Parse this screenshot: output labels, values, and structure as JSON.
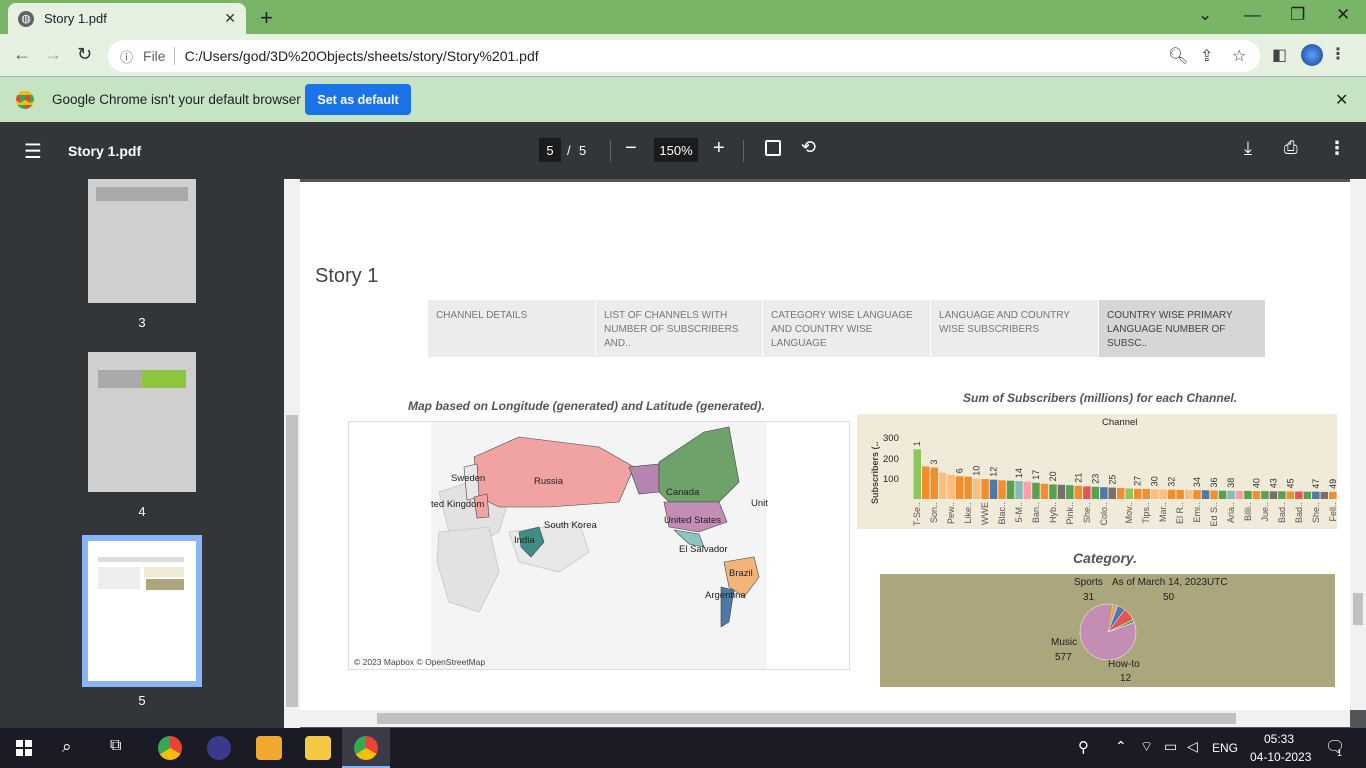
{
  "browser": {
    "tab_title": "Story 1.pdf",
    "tab_close": "✕",
    "new_tab": "+",
    "file_label": "File",
    "url": "C:/Users/god/3D%20Objects/sheets/story/Story%201.pdf",
    "infobar_message": "Google Chrome isn't your default browser",
    "set_default_label": "Set as default",
    "infobar_close": "✕"
  },
  "pdf": {
    "title": "Story 1.pdf",
    "current_page": "5",
    "page_sep": "/",
    "total_pages": "5",
    "zoom": "150%"
  },
  "thumbnails": [
    {
      "label": "3"
    },
    {
      "label": "4"
    },
    {
      "label": "5"
    }
  ],
  "story": {
    "title": "Story 1",
    "tabs": [
      "CHANNEL DETAILS",
      "LIST OF CHANNELS WITH NUMBER OF SUBSCRIBERS AND..",
      "CATEGORY WISE LANGUAGE AND COUNTRY WISE LANGUAGE",
      "LANGUAGE AND COUNTRY WISE SUBSCRIBERS",
      "COUNTRY WISE PRIMARY LANGUAGE NUMBER OF SUBSC.."
    ]
  },
  "map": {
    "title": "Map based on Longitude (generated) and Latitude (generated).",
    "attribution": "© 2023 Mapbox © OpenStreetMap",
    "labels": {
      "sweden": "Sweden",
      "uk": "ted Kingdom",
      "russia": "Russia",
      "south_korea": "South Korea",
      "india": "India",
      "canada": "Canada",
      "united_states": "United States",
      "el_salvador": "El Salvador",
      "brazil": "Brazil",
      "argentina": "Argentina",
      "unit": "Unit"
    }
  },
  "chart_data": [
    {
      "type": "bar",
      "title": "Sum of Subscribers (millions) for each Channel.",
      "header": "Channel",
      "ylabel": "Subscribers (..",
      "yticks": [
        "300",
        "200",
        "100"
      ],
      "ylim": [
        0,
        350
      ],
      "categories": [
        "T-Se..",
        "Son..",
        "Pew..",
        "Like..",
        "WWE",
        "Blac..",
        "5-M..",
        "Ban..",
        "Hyb..",
        "Pink..",
        "She..",
        "Colo..",
        "Mov..",
        "Tips..",
        "Mar..",
        "El R..",
        "Emi..",
        "Ed S..",
        "Aria..",
        "Billi..",
        "Jue..",
        "Bad..",
        "Bad..",
        "She..",
        "Fell.."
      ],
      "values": [
        245,
        160,
        155,
        130,
        120,
        112,
        110,
        100,
        98,
        95,
        92,
        90,
        88,
        85,
        80,
        75,
        72,
        70,
        68,
        65,
        62,
        60,
        58,
        56,
        54,
        52,
        50,
        50,
        48,
        47,
        46,
        45,
        44,
        44,
        43,
        42,
        41,
        41,
        40,
        40,
        39,
        39,
        38,
        38,
        37,
        37,
        36,
        36,
        35,
        35
      ],
      "data_labels": [
        "1",
        "3",
        "6",
        "10",
        "12",
        "14",
        "17",
        "20",
        "21",
        "23",
        "25",
        "27",
        "30",
        "32",
        "34",
        "36",
        "38",
        "40",
        "43",
        "45",
        "47",
        "49"
      ]
    },
    {
      "type": "pie",
      "title": "Category.",
      "slices": [
        {
          "name": "Music",
          "value": 577,
          "color": "#c38db5"
        },
        {
          "name": "How-to",
          "value": 12,
          "color": "#59a14f"
        },
        {
          "name": "As of March 14, 2023UTC",
          "value": 50,
          "color": "#e15759"
        },
        {
          "name": "Sports",
          "value": 31,
          "color": "#4e79a7"
        }
      ],
      "extra_colors": [
        "#f28e2b",
        "#edc948",
        "#76b7b2",
        "#ff9da7"
      ]
    }
  ],
  "taskbar": {
    "time": "05:33",
    "date": "04-10-2023",
    "lang": "ENG",
    "notif_count": "1"
  }
}
